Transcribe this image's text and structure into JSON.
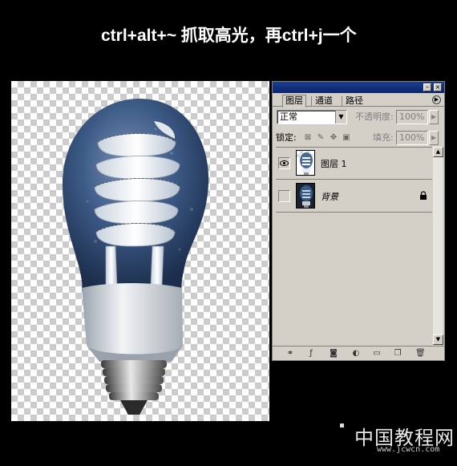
{
  "instruction": {
    "text": "ctrl+alt+~ 抓取高光，再ctrl+j一个"
  },
  "panel": {
    "tabs": [
      {
        "label": "图层"
      },
      {
        "label": "通道"
      },
      {
        "label": "路径"
      }
    ],
    "blend_mode": "正常",
    "opacity_label": "不透明度:",
    "opacity_value": "100%",
    "lock_label": "锁定:",
    "fill_label": "填充:",
    "fill_value": "100%",
    "layers": [
      {
        "name": "图层 1",
        "visible": true,
        "selected": true
      },
      {
        "name": "背景",
        "visible": false,
        "locked": true
      }
    ],
    "bottom_icons": [
      "link-icon",
      "layer-style-icon",
      "mask-icon",
      "adjustment-icon",
      "folder-icon",
      "new-layer-icon",
      "trash-icon"
    ]
  },
  "watermark": {
    "text": "中国教程网",
    "url": "www.jcwcn.com"
  },
  "colors": {
    "background": "#000000",
    "panel": "#d4d0c8",
    "titlebar": "#0a246a",
    "bulb_glass": "#2e4a74"
  }
}
